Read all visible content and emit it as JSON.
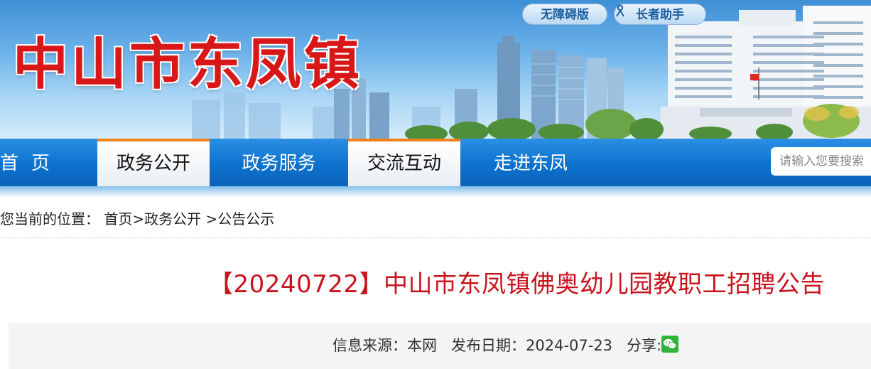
{
  "site": {
    "title": "中山市东凤镇"
  },
  "top_buttons": {
    "accessible": "无障碍版",
    "elder": "长者助手"
  },
  "nav": {
    "items": [
      {
        "label": "首页"
      },
      {
        "label": "政务公开"
      },
      {
        "label": "政务服务"
      },
      {
        "label": "交流互动"
      },
      {
        "label": "走进东凤"
      }
    ],
    "search_placeholder": "请输入您要搜索"
  },
  "breadcrumb": {
    "prefix": "您当前的位置：",
    "home": "首页",
    "sep1": ">",
    "section": "政务公开",
    "sep2": " >",
    "current": "公告公示"
  },
  "article": {
    "title": "【20240722】中山市东凤镇佛奥幼儿园教职工招聘公告",
    "source_label": "信息来源：",
    "source": "本网",
    "date_label": "发布日期：",
    "date": "2024-07-23",
    "share_label": "分享:"
  },
  "icons": {
    "share": "wechat-icon",
    "elder": "person-icon"
  },
  "colors": {
    "title_red": "#d81818",
    "nav_blue": "#0d72cf",
    "active_tab_border": "#f0821c",
    "article_title": "#c9141e"
  }
}
